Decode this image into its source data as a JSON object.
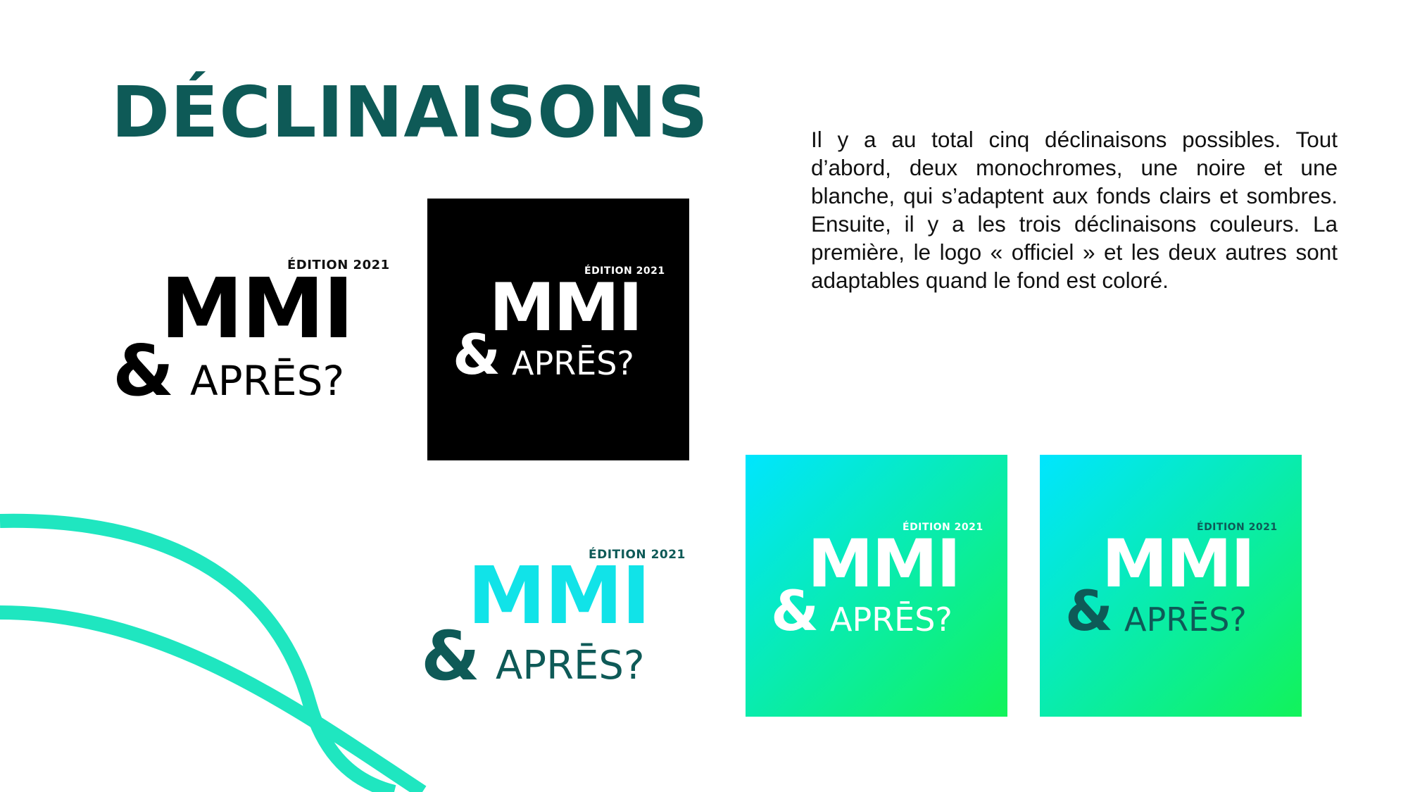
{
  "slide": {
    "title": "DÉCLINAISONS",
    "body": "Il y a au total cinq déclinaisons possibles. Tout d’abord, deux monochromes, une noire et une blanche, qui s’adaptent aux fonds clairs et sombres. Ensuite, il y a les trois déclinaisons couleurs. La première, le logo « officiel » et les deux autres sont adaptables quand le fond est coloré."
  },
  "colors": {
    "title": "#0e5a57",
    "wave": "#1fe6c0",
    "black": "#000000",
    "white": "#ffffff",
    "teal_dark": "#0e5a57",
    "cyan": "#11e3e8",
    "gradient_start": "#00e5ff",
    "gradient_end": "#12f35a"
  },
  "logos": [
    {
      "variant": "black-on-white",
      "edition": "ÉDITION 2021",
      "mmi": "MMI",
      "ampersand": "&",
      "apres": "APRĒS?"
    },
    {
      "variant": "white-on-black",
      "edition": "ÉDITION 2021",
      "mmi": "MMI",
      "ampersand": "&",
      "apres": "APRĒS?"
    },
    {
      "variant": "official-color",
      "edition": "ÉDITION 2021",
      "mmi": "MMI",
      "ampersand": "&",
      "apres": "APRĒS?"
    },
    {
      "variant": "white-on-gradient",
      "edition": "ÉDITION 2021",
      "mmi": "MMI",
      "ampersand": "&",
      "apres": "APRĒS?"
    },
    {
      "variant": "teal-white-on-gradient",
      "edition": "ÉDITION 2021",
      "mmi": "MMI",
      "ampersand": "&",
      "apres": "APRĒS?"
    }
  ]
}
